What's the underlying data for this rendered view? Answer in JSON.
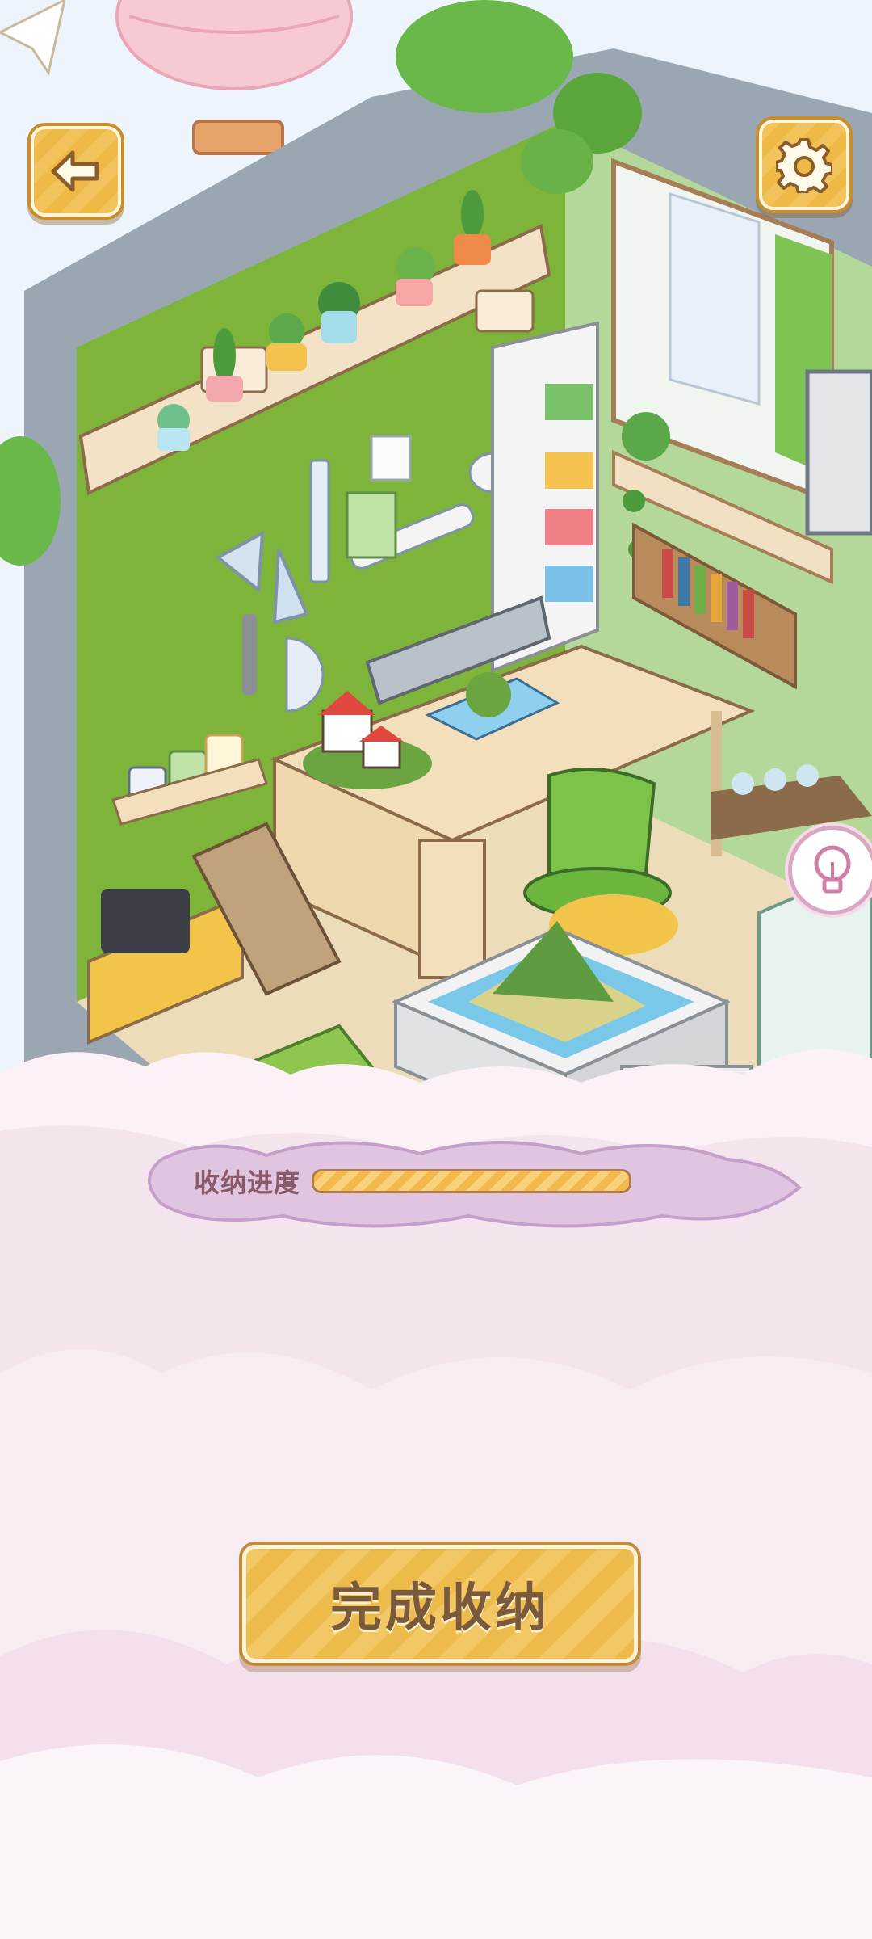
{
  "scene": {
    "wall_color": "#7fb43a",
    "floor_color": "#eddcba",
    "cloud_color": "#f6e8f1"
  },
  "toolbar": {
    "back_icon": "back-arrow-icon",
    "settings_icon": "gear-icon"
  },
  "progress": {
    "label": "收纳进度",
    "value": 1.0
  },
  "actions": {
    "complete_label": "完成收纳"
  },
  "hint": {
    "icon": "lightbulb-icon"
  }
}
